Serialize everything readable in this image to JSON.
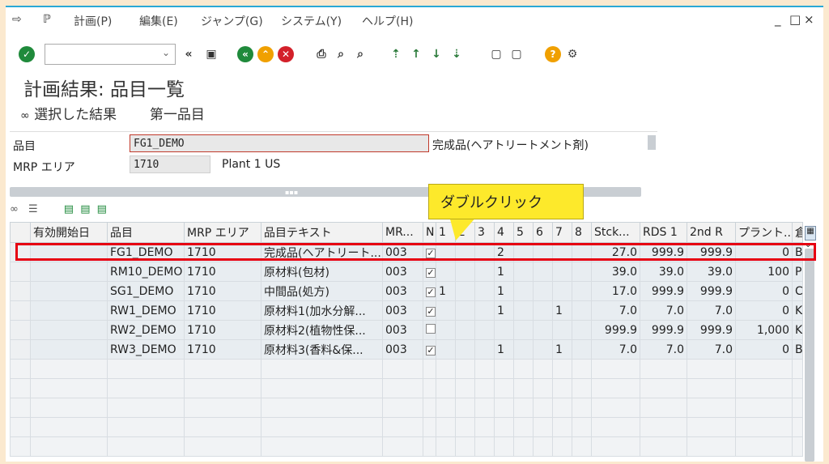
{
  "menu": {
    "items": [
      "計画(P)",
      "編集(E)",
      "ジャンプ(G)",
      "システム(Y)",
      "ヘルプ(H)"
    ],
    "window_controls": [
      "_",
      "□",
      "×"
    ]
  },
  "toolbar": {
    "command_field": ""
  },
  "page": {
    "title": "計画結果: 品目一覧",
    "selected_results": "選択した結果",
    "first_item": "第一品目"
  },
  "header": {
    "material_label": "品目",
    "material_value": "FG1_DEMO",
    "material_desc": "完成品(ヘアトリートメント剤)",
    "mrp_area_label": "MRP エリア",
    "mrp_area_value": "1710",
    "mrp_area_desc": "Plant 1 US"
  },
  "callout": {
    "text": "ダブルクリック"
  },
  "table": {
    "columns": [
      "有効開始日",
      "品目",
      "MRP エリア",
      "品目テキスト",
      "MR...",
      "N",
      "1",
      "2",
      "3",
      "4",
      "5",
      "6",
      "7",
      "8",
      "Stck...",
      "RDS 1",
      "2nd R",
      "プラント...",
      "倉"
    ],
    "rows": [
      {
        "date": "",
        "material": "FG1_DEMO",
        "area": "1710",
        "text": "完成品(ヘアトリート...",
        "mr": "003",
        "n": true,
        "c1": "",
        "c2": "",
        "c3": "",
        "c4": "2",
        "c5": "",
        "c6": "",
        "c7": "",
        "c8": "",
        "stock": "27.0",
        "rds1": "999.9",
        "rds2": "999.9",
        "plant": "0",
        "last": "B"
      },
      {
        "date": "",
        "material": "RM10_DEMO",
        "area": "1710",
        "text": "原材料(包材)",
        "mr": "003",
        "n": true,
        "c1": "",
        "c2": "",
        "c3": "",
        "c4": "1",
        "c5": "",
        "c6": "",
        "c7": "",
        "c8": "",
        "stock": "39.0",
        "rds1": "39.0",
        "rds2": "39.0",
        "plant": "100",
        "last": "P"
      },
      {
        "date": "",
        "material": "SG1_DEMO",
        "area": "1710",
        "text": "中間品(処方)",
        "mr": "003",
        "n": true,
        "c1": "1",
        "c2": "",
        "c3": "",
        "c4": "1",
        "c5": "",
        "c6": "",
        "c7": "",
        "c8": "",
        "stock": "17.0",
        "rds1": "999.9",
        "rds2": "999.9",
        "plant": "0",
        "last": "C"
      },
      {
        "date": "",
        "material": "RW1_DEMO",
        "area": "1710",
        "text": "原材料1(加水分解...",
        "mr": "003",
        "n": true,
        "c1": "",
        "c2": "",
        "c3": "",
        "c4": "1",
        "c5": "",
        "c6": "",
        "c7": "1",
        "c8": "",
        "stock": "7.0",
        "rds1": "7.0",
        "rds2": "7.0",
        "plant": "0",
        "last": "K"
      },
      {
        "date": "",
        "material": "RW2_DEMO",
        "area": "1710",
        "text": "原材料2(植物性保...",
        "mr": "003",
        "n": false,
        "c1": "",
        "c2": "",
        "c3": "",
        "c4": "",
        "c5": "",
        "c6": "",
        "c7": "",
        "c8": "",
        "stock": "999.9",
        "rds1": "999.9",
        "rds2": "999.9",
        "plant": "1,000",
        "last": "K"
      },
      {
        "date": "",
        "material": "RW3_DEMO",
        "area": "1710",
        "text": "原材料3(香料&保...",
        "mr": "003",
        "n": true,
        "c1": "",
        "c2": "",
        "c3": "",
        "c4": "1",
        "c5": "",
        "c6": "",
        "c7": "1",
        "c8": "",
        "stock": "7.0",
        "rds1": "7.0",
        "rds2": "7.0",
        "plant": "0",
        "last": "B"
      }
    ]
  },
  "colors": {
    "accent": "#2aa8d6",
    "highlight_border": "#e60012",
    "callout": "#fde92b"
  }
}
